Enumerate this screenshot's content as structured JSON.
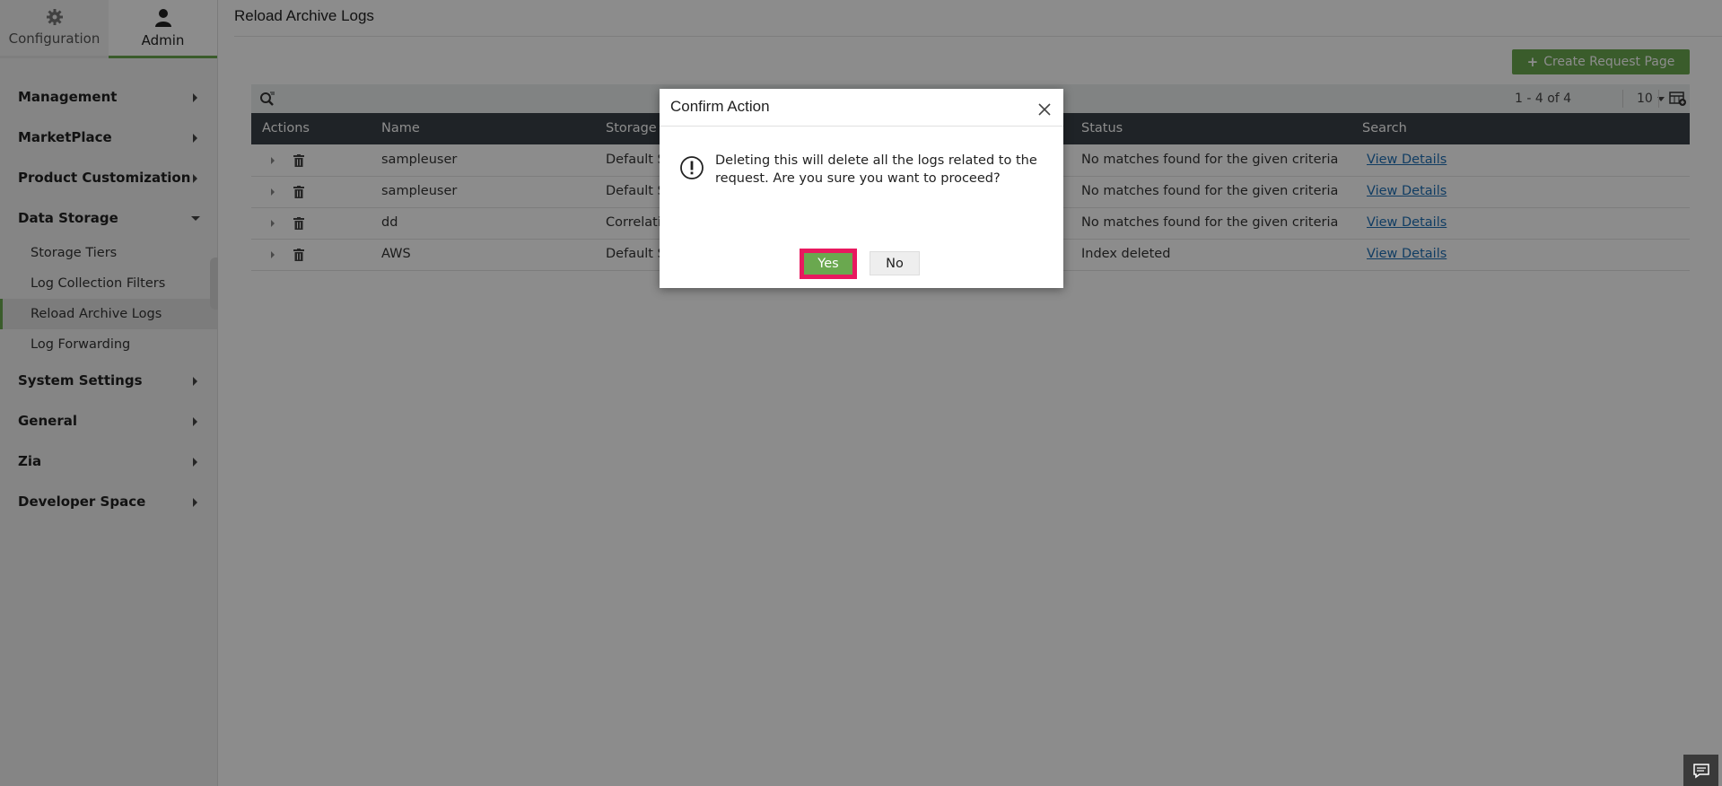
{
  "topnav": {
    "configuration_label": "Configuration",
    "admin_label": "Admin"
  },
  "sidebar": {
    "groups": [
      {
        "label": "Management",
        "expanded": false
      },
      {
        "label": "MarketPlace",
        "expanded": false
      },
      {
        "label": "Product Customization",
        "expanded": false
      },
      {
        "label": "Data Storage",
        "expanded": true
      },
      {
        "label": "System Settings",
        "expanded": false
      },
      {
        "label": "General",
        "expanded": false
      },
      {
        "label": "Zia",
        "expanded": false
      },
      {
        "label": "Developer Space",
        "expanded": false
      }
    ],
    "data_storage_items": [
      {
        "label": "Storage Tiers",
        "active": false
      },
      {
        "label": "Log Collection Filters",
        "active": false
      },
      {
        "label": "Reload Archive Logs",
        "active": true
      },
      {
        "label": "Log Forwarding",
        "active": false
      }
    ]
  },
  "main": {
    "title": "Reload Archive Logs",
    "create_button_label": "Create Request Page",
    "pager_text": "1 - 4 of 4",
    "per_page": "10",
    "columns": [
      "Actions",
      "Name",
      "Storage",
      "Status",
      "Search"
    ],
    "rows": [
      {
        "name": "sampleuser",
        "storage": "Default S",
        "status": "No matches found for the given criteria",
        "search": "View Details"
      },
      {
        "name": "sampleuser",
        "storage": "Default S",
        "status": "No matches found for the given criteria",
        "search": "View Details"
      },
      {
        "name": "dd",
        "storage": "Correlatio",
        "status": "No matches found for the given criteria",
        "search": "View Details"
      },
      {
        "name": "AWS",
        "storage": "Default S",
        "status": "Index deleted",
        "search": "View Details"
      }
    ]
  },
  "dialog": {
    "title": "Confirm Action",
    "message": "Deleting this will delete all the logs related to the request. Are you sure you want to proceed?",
    "yes_label": "Yes",
    "no_label": "No"
  },
  "colors": {
    "accent_green": "#6aa84f",
    "header_dark": "#3a4147",
    "highlight": "#e8195f",
    "link": "#1f6fb5"
  }
}
